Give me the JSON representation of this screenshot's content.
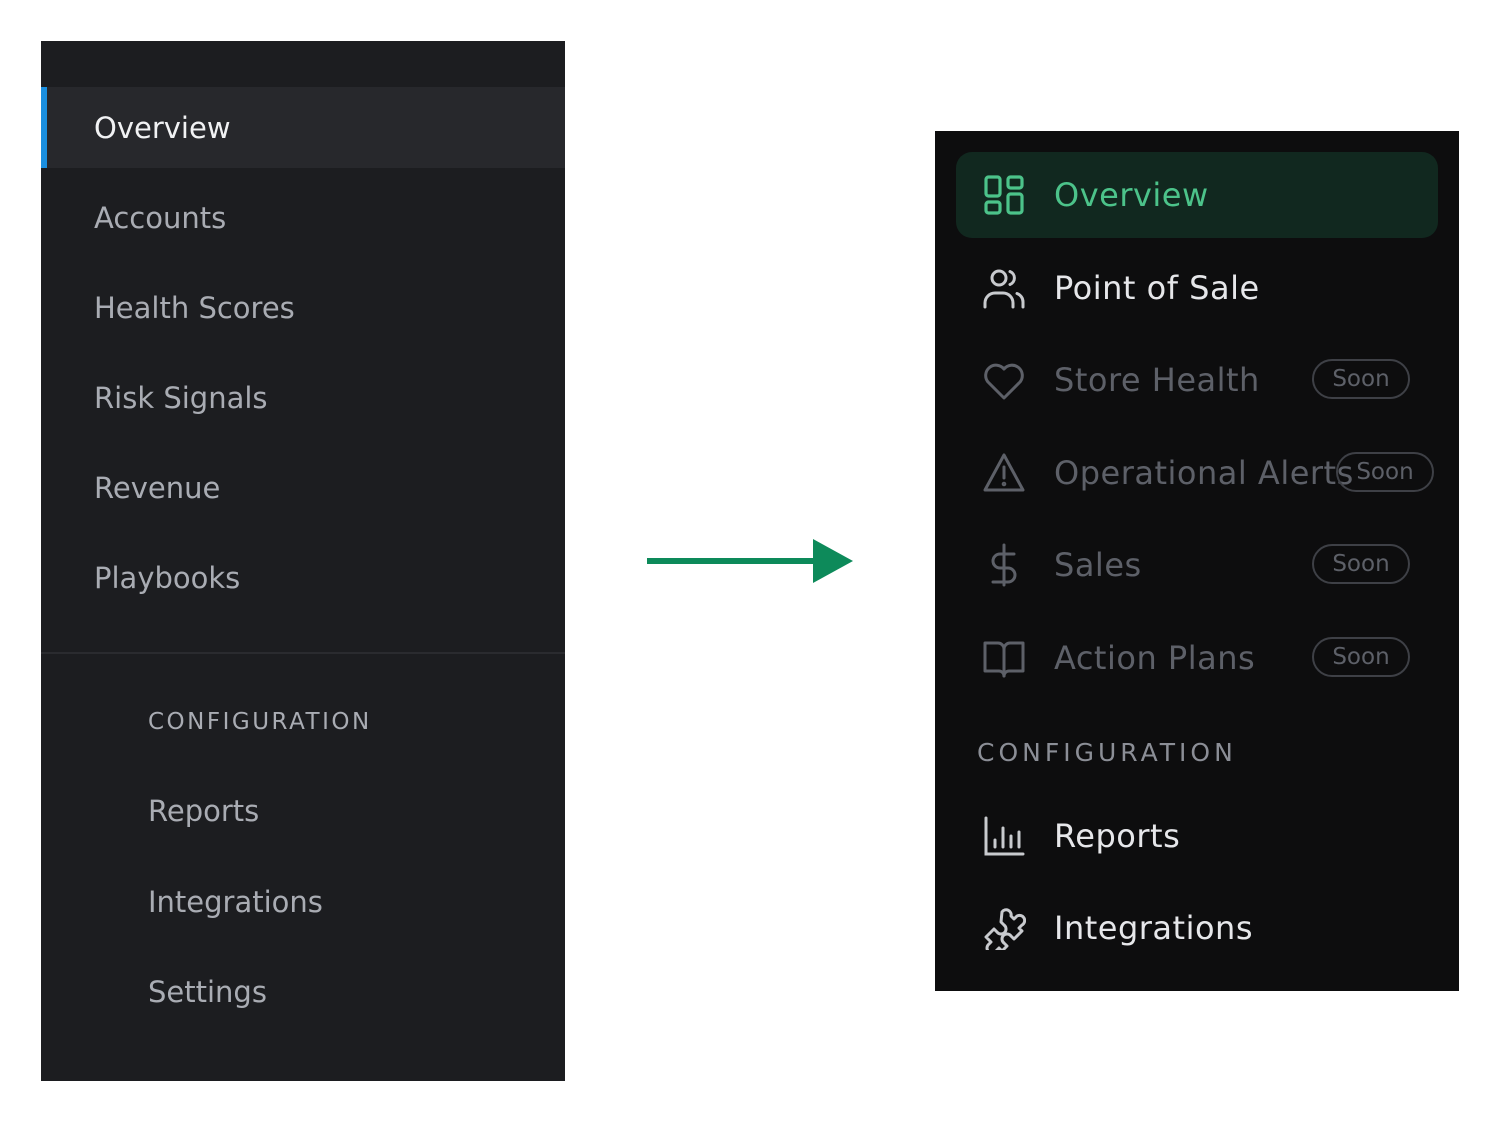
{
  "before": {
    "nav": [
      {
        "label": "Overview"
      },
      {
        "label": "Accounts"
      },
      {
        "label": "Health Scores"
      },
      {
        "label": "Risk Signals"
      },
      {
        "label": "Revenue"
      },
      {
        "label": "Playbooks"
      }
    ],
    "section_label": "CONFIGURATION",
    "config": [
      {
        "label": "Reports"
      },
      {
        "label": "Integrations"
      },
      {
        "label": "Settings"
      }
    ],
    "colors": {
      "accent": "#1a8fe0",
      "background": "#1c1d20",
      "active_bg": "#27282c"
    }
  },
  "arrow": {
    "color": "#0d8a5a",
    "icon": "arrow-right-icon"
  },
  "after": {
    "nav": [
      {
        "label": "Overview",
        "icon": "grid-icon"
      },
      {
        "label": "Point of Sale",
        "icon": "users-icon"
      },
      {
        "label": "Store Health",
        "icon": "heart-icon",
        "badge": "Soon"
      },
      {
        "label": "Operational Alerts",
        "icon": "alert-triangle-icon",
        "badge": "Soon"
      },
      {
        "label": "Sales",
        "icon": "dollar-icon",
        "badge": "Soon"
      },
      {
        "label": "Action Plans",
        "icon": "book-open-icon",
        "badge": "Soon"
      }
    ],
    "section_label": "CONFIGURATION",
    "config": [
      {
        "label": "Reports",
        "icon": "bar-chart-icon"
      },
      {
        "label": "Integrations",
        "icon": "puzzle-icon"
      }
    ],
    "colors": {
      "accent": "#4cc38a",
      "background": "#0d0d0e",
      "active_bg": "#11281f"
    }
  }
}
